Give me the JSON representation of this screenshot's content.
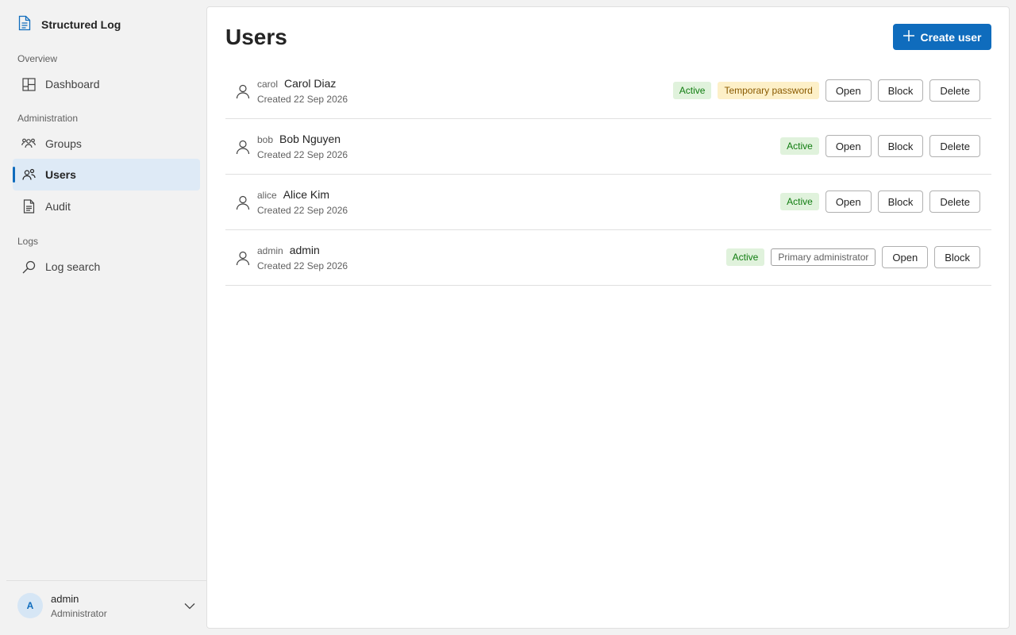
{
  "sidebar": {
    "brand": {
      "title": "Structured Log",
      "icon": "document-icon"
    },
    "sections": {
      "overview": "Overview",
      "administration": "Administration",
      "logs": "Logs"
    },
    "items": {
      "dashboard": "Dashboard",
      "groups": "Groups",
      "users": "Users",
      "audit": "Audit",
      "log_search": "Log search"
    },
    "active_item": "users",
    "footer": {
      "avatar_initial": "A",
      "user_name": "admin",
      "user_role": "Administrator"
    }
  },
  "main": {
    "title": "Users",
    "create_button": "Create user",
    "users": [
      {
        "username": "carol",
        "full_name": "Carol Diaz",
        "created": "Created 22 Sep 2026",
        "status": "Active",
        "extra_badge": "Temporary password",
        "extra_badge_kind": "warn",
        "actions": {
          "open": "Open",
          "block": "Block",
          "delete": "Delete"
        }
      },
      {
        "username": "bob",
        "full_name": "Bob Nguyen",
        "created": "Created 22 Sep 2026",
        "status": "Active",
        "actions": {
          "open": "Open",
          "block": "Block",
          "delete": "Delete"
        }
      },
      {
        "username": "alice",
        "full_name": "Alice Kim",
        "created": "Created 22 Sep 2026",
        "status": "Active",
        "actions": {
          "open": "Open",
          "block": "Block",
          "delete": "Delete"
        }
      },
      {
        "username": "admin",
        "full_name": "admin",
        "created": "Created 22 Sep 2026",
        "status": "Active",
        "extra_badge": "Primary administrator",
        "extra_badge_kind": "outline",
        "actions": {
          "open": "Open",
          "block": "Block"
        }
      }
    ]
  },
  "colors": {
    "accent": "#0f6cbd",
    "active_badge_bg": "#e0f2dc",
    "active_badge_text": "#107c10",
    "warn_badge_bg": "#fdf0c8",
    "selected_nav_bg": "#deeaf6"
  }
}
